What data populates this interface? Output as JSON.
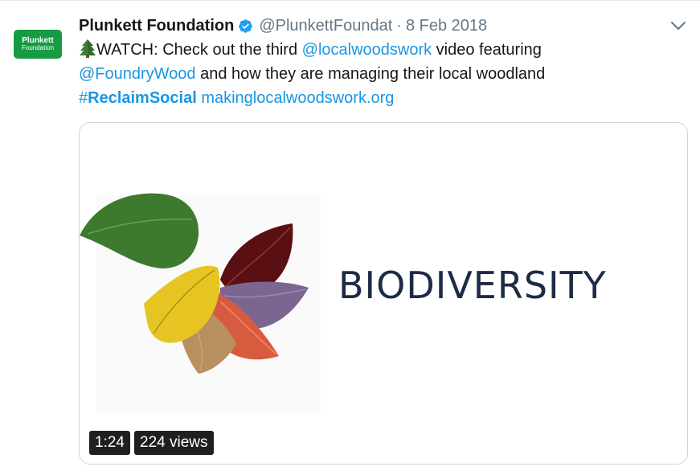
{
  "tweet": {
    "avatar": {
      "line1": "Plunkett",
      "line2": "Foundation"
    },
    "author": {
      "name": "Plunkett Foundation",
      "handle": "@PlunkettFoundat",
      "separator": "·",
      "date": "8 Feb 2018"
    },
    "text": {
      "watch": "WATCH: Check out the third ",
      "mention1": "@localwoodswork",
      "after_mention1": " video featuring",
      "mention2": "@FoundryWood",
      "after_mention2": " and how they are managing their local woodland",
      "hashtag_symbol": "#",
      "hashtag_text": "ReclaimSocial",
      "space": " ",
      "url": "makinglocalwoodswork.org"
    },
    "media": {
      "title": "BIODIVERSITY",
      "duration": "1:24",
      "views": "224 views"
    },
    "icons": {
      "verified": "verified-badge-icon",
      "tree": "evergreen-tree-icon",
      "caret": "chevron-down-icon"
    },
    "colors": {
      "link": "#1b95e0",
      "avatar_bg": "#169b43",
      "muted": "#657786"
    }
  }
}
